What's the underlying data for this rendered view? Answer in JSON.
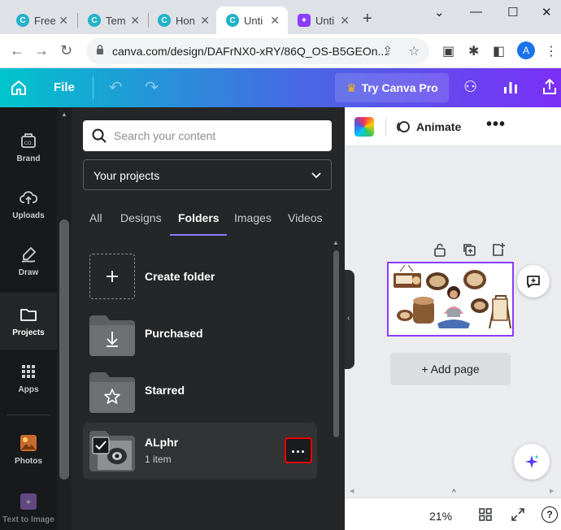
{
  "browser": {
    "tabs": [
      {
        "title": "Free",
        "favicon": "canva-icon",
        "active": false
      },
      {
        "title": "Tem",
        "favicon": "canva-icon",
        "active": false
      },
      {
        "title": "Hon",
        "favicon": "canva-icon",
        "active": false
      },
      {
        "title": "Unti",
        "favicon": "canva-icon",
        "active": true
      },
      {
        "title": "Unti",
        "favicon": "canva-purple-icon",
        "active": false
      }
    ],
    "url": "canva.com/design/DAFrNX0-xRY/86Q_OS-B5GEOn...",
    "profile_initial": "A",
    "icons": {
      "back": "back-arrow-icon",
      "forward": "forward-arrow-icon",
      "reload": "reload-icon",
      "share": "share-icon",
      "star": "star-icon",
      "extensions": "puzzle-icon"
    }
  },
  "canva_bar": {
    "file_label": "File",
    "try_pro_label": "Try Canva Pro",
    "gradient_colors": [
      "#00c4cc",
      "#4a66e5",
      "#7b2ff7"
    ]
  },
  "rail": {
    "items": [
      {
        "label": "Brand",
        "icon": "brand-icon"
      },
      {
        "label": "Uploads",
        "icon": "upload-cloud-icon"
      },
      {
        "label": "Draw",
        "icon": "draw-icon"
      },
      {
        "label": "Projects",
        "icon": "folder-icon",
        "active": true
      },
      {
        "label": "Apps",
        "icon": "apps-grid-icon"
      },
      {
        "label": "Photos",
        "icon": "photos-icon"
      },
      {
        "label": "Text to Image",
        "icon": "text-to-image-icon"
      }
    ]
  },
  "panel": {
    "search_placeholder": "Search your content",
    "filter_value": "Your projects",
    "tabs": [
      {
        "label": "All"
      },
      {
        "label": "Designs"
      },
      {
        "label": "Folders",
        "active": true
      },
      {
        "label": "Images"
      },
      {
        "label": "Videos"
      }
    ],
    "folders": [
      {
        "name": "Create folder",
        "sub": "",
        "icon": "plus-icon"
      },
      {
        "name": "Purchased",
        "sub": "",
        "icon": "download-icon"
      },
      {
        "name": "Starred",
        "sub": "",
        "icon": "star-icon"
      },
      {
        "name": "ALphr",
        "sub": "1 item",
        "icon": "folder-thumbnail"
      }
    ],
    "accent": "#8b7cff",
    "highlight": "#ee0000"
  },
  "editor": {
    "animate_label": "Animate",
    "add_page_label": "+ Add page",
    "zoom": "21%",
    "help_label": "?",
    "selection_color": "#8b3dff"
  }
}
